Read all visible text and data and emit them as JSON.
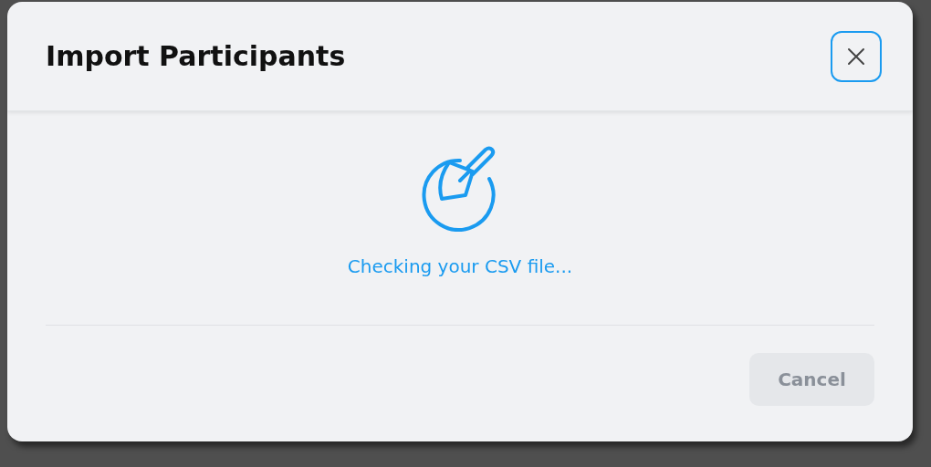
{
  "dialog": {
    "title": "Import Participants",
    "status": "Checking your CSV file...",
    "buttons": [
      {
        "label": "Cancel",
        "disabled": true
      }
    ]
  }
}
